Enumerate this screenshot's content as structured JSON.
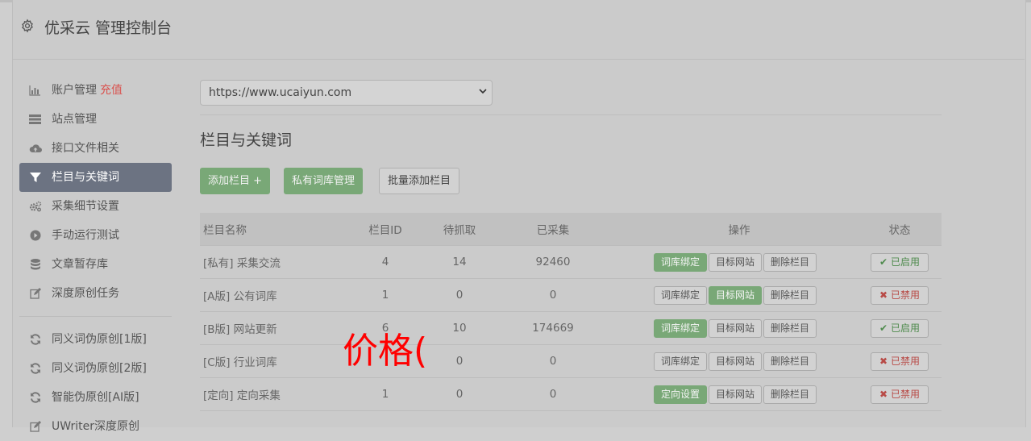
{
  "app": {
    "title": "优采云 管理控制台"
  },
  "sidebar": {
    "items": [
      {
        "label": "账户管理",
        "extra": "充值",
        "icon": "bar-chart-icon",
        "active": false
      },
      {
        "label": "站点管理",
        "icon": "server-icon",
        "active": false
      },
      {
        "label": "接口文件相关",
        "icon": "cloud-upload-icon",
        "active": false
      },
      {
        "label": "栏目与关键词",
        "icon": "filter-icon",
        "active": true
      },
      {
        "label": "采集细节设置",
        "icon": "cogs-icon",
        "active": false
      },
      {
        "label": "手动运行测试",
        "icon": "play-circle-icon",
        "active": false
      },
      {
        "label": "文章暂存库",
        "icon": "database-icon",
        "active": false
      },
      {
        "label": "深度原创任务",
        "icon": "edit-icon",
        "active": false
      }
    ],
    "items2": [
      {
        "label": "同义词伪原创[1版]",
        "icon": "refresh-icon"
      },
      {
        "label": "同义词伪原创[2版]",
        "icon": "refresh-icon"
      },
      {
        "label": "智能伪原创[AI版]",
        "icon": "refresh-icon"
      },
      {
        "label": "UWriter深度原创",
        "icon": "edit-icon"
      }
    ]
  },
  "main": {
    "site_select": {
      "value": "https://www.ucaiyun.com"
    },
    "section_title": "栏目与关键词",
    "buttons": {
      "add_column": "添加栏目 +",
      "private_lexicon": "私有词库管理",
      "batch_add": "批量添加栏目"
    },
    "table": {
      "headers": [
        "栏目名称",
        "栏目ID",
        "待抓取",
        "已采集",
        "操作",
        "状态"
      ],
      "rows": [
        {
          "tag": "[私有]",
          "name": "采集交流",
          "color": "green",
          "id": "4",
          "pending": "14",
          "collected": "92460",
          "op1": "词库绑定",
          "op1_active": true,
          "op2": "目标网站",
          "op2_active": false,
          "op3": "删除栏目",
          "status": "已启用",
          "status_on": true
        },
        {
          "tag": "[A版]",
          "name": "公有词库",
          "color": "dark",
          "id": "1",
          "pending": "0",
          "collected": "0",
          "op1": "词库绑定",
          "op1_active": false,
          "op2": "目标网站",
          "op2_active": true,
          "op3": "删除栏目",
          "status": "已禁用",
          "status_on": false
        },
        {
          "tag": "[B版]",
          "name": "网站更新",
          "color": "blue",
          "id": "6",
          "pending": "10",
          "collected": "174669",
          "op1": "词库绑定",
          "op1_active": true,
          "op2": "目标网站",
          "op2_active": false,
          "op3": "删除栏目",
          "status": "已启用",
          "status_on": true
        },
        {
          "tag": "[C版]",
          "name": "行业词库",
          "color": "red",
          "id": "",
          "pending": "0",
          "collected": "0",
          "op1": "词库绑定",
          "op1_active": false,
          "op2": "目标网站",
          "op2_active": false,
          "op3": "删除栏目",
          "status": "已禁用",
          "status_on": false
        },
        {
          "tag": "[定向]",
          "name": "定向采集",
          "color": "purple",
          "id": "1",
          "pending": "0",
          "collected": "0",
          "op1": "定向设置",
          "op1_active": true,
          "op2": "目标网站",
          "op2_active": false,
          "op3": "删除栏目",
          "status": "已禁用",
          "status_on": false
        }
      ]
    }
  },
  "overlay": {
    "text": "价格("
  },
  "colors": {
    "accent_green": "#79a877",
    "active_nav": "#6c7382",
    "danger": "#d9534f",
    "overlay_red": "#ff0000"
  }
}
